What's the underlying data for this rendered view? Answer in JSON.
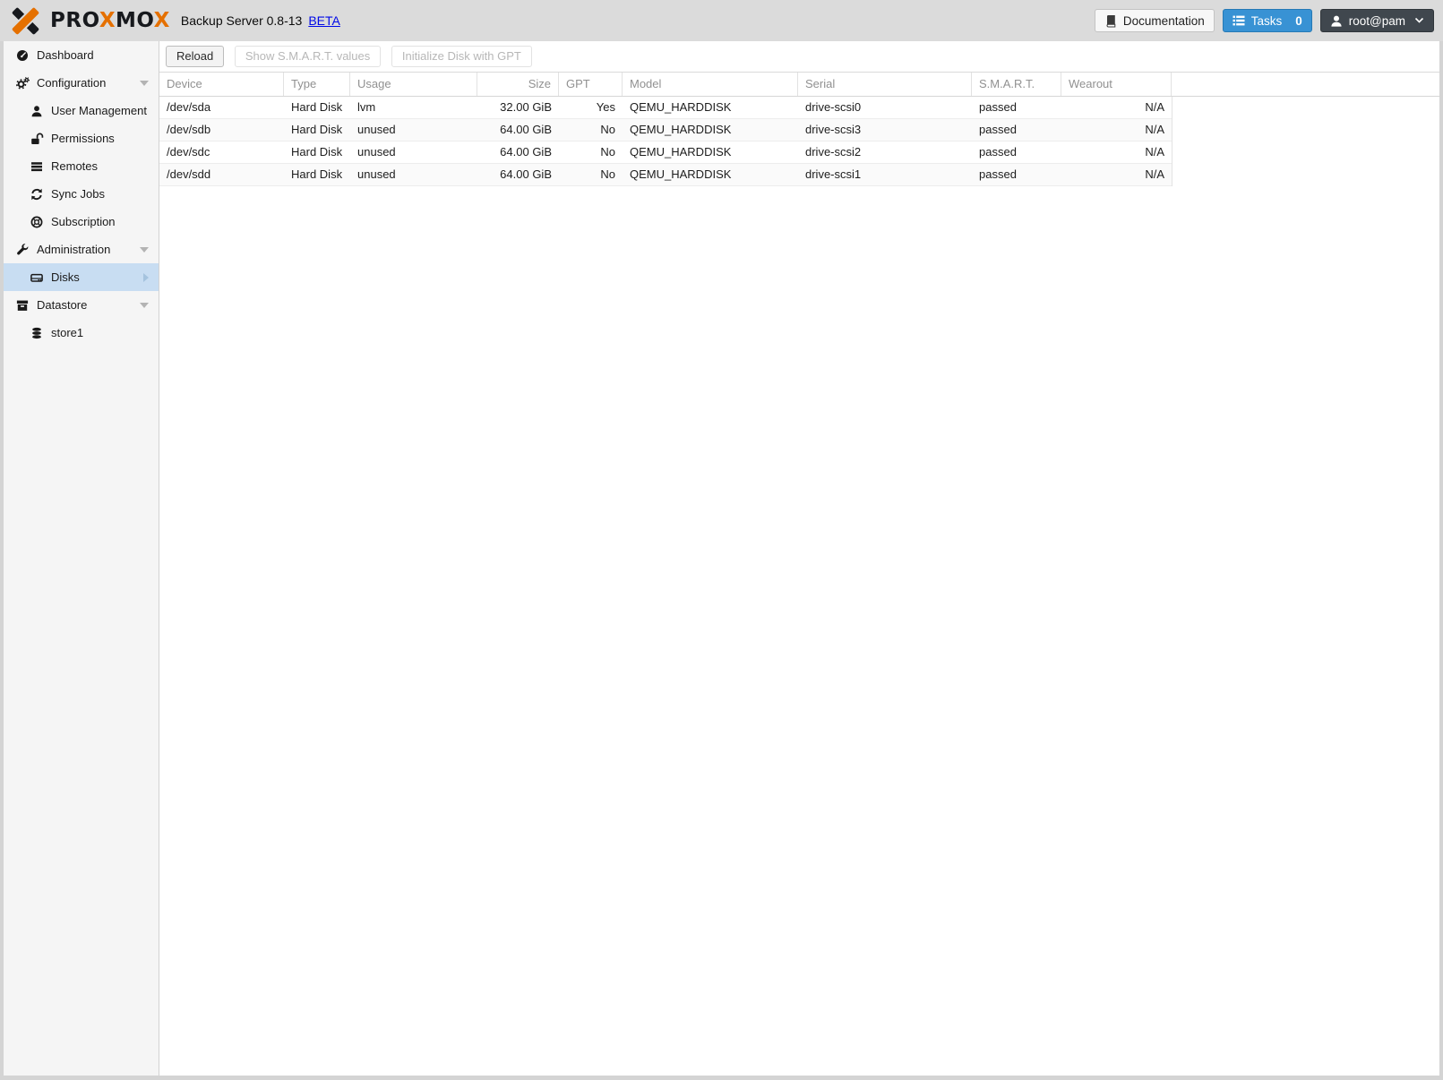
{
  "topbar": {
    "brand": {
      "part1": "PRO",
      "part2": "X",
      "part3": "MO",
      "part4": "X"
    },
    "title": "Backup Server 0.8-13",
    "beta_link": "BETA",
    "documentation_button": "Documentation",
    "tasks_button": "Tasks",
    "tasks_count": "0",
    "user_menu": "root@pam"
  },
  "sidebar": {
    "items": [
      {
        "label": "Dashboard",
        "icon": "tachometer-icon",
        "level": 0
      },
      {
        "label": "Configuration",
        "icon": "gears-icon",
        "level": 0,
        "expander": "down"
      },
      {
        "label": "User Management",
        "icon": "user-icon",
        "level": 1
      },
      {
        "label": "Permissions",
        "icon": "unlock-icon",
        "level": 1
      },
      {
        "label": "Remotes",
        "icon": "list-icon",
        "level": 1
      },
      {
        "label": "Sync Jobs",
        "icon": "sync-icon",
        "level": 1
      },
      {
        "label": "Subscription",
        "icon": "life-ring-icon",
        "level": 1
      },
      {
        "label": "Administration",
        "icon": "wrench-icon",
        "level": 0,
        "expander": "down"
      },
      {
        "label": "Disks",
        "icon": "hdd-icon",
        "level": 1,
        "selected": true,
        "expander": "right"
      },
      {
        "label": "Datastore",
        "icon": "archive-icon",
        "level": 0,
        "expander": "down"
      },
      {
        "label": "store1",
        "icon": "database-icon",
        "level": 1
      }
    ]
  },
  "toolbar": {
    "buttons": [
      {
        "label": "Reload",
        "enabled": true
      },
      {
        "label": "Show S.M.A.R.T. values",
        "enabled": false
      },
      {
        "label": "Initialize Disk with GPT",
        "enabled": false
      }
    ]
  },
  "disks_table": {
    "columns": [
      "Device",
      "Type",
      "Usage",
      "Size",
      "GPT",
      "Model",
      "Serial",
      "S.M.A.R.T.",
      "Wearout"
    ],
    "rows": [
      [
        "/dev/sda",
        "Hard Disk",
        "lvm",
        "32.00 GiB",
        "Yes",
        "QEMU_HARDDISK",
        "drive-scsi0",
        "passed",
        "N/A"
      ],
      [
        "/dev/sdb",
        "Hard Disk",
        "unused",
        "64.00 GiB",
        "No",
        "QEMU_HARDDISK",
        "drive-scsi3",
        "passed",
        "N/A"
      ],
      [
        "/dev/sdc",
        "Hard Disk",
        "unused",
        "64.00 GiB",
        "No",
        "QEMU_HARDDISK",
        "drive-scsi2",
        "passed",
        "N/A"
      ],
      [
        "/dev/sdd",
        "Hard Disk",
        "unused",
        "64.00 GiB",
        "No",
        "QEMU_HARDDISK",
        "drive-scsi1",
        "passed",
        "N/A"
      ]
    ]
  },
  "colors": {
    "brand_orange": "#e57000",
    "brand_dark": "#17191d",
    "tasks_button_blue": "#3892d4",
    "user_button_dark": "#40474e",
    "selected_item_blue": "#c8ddf2",
    "link_blue": "#0009e8"
  }
}
